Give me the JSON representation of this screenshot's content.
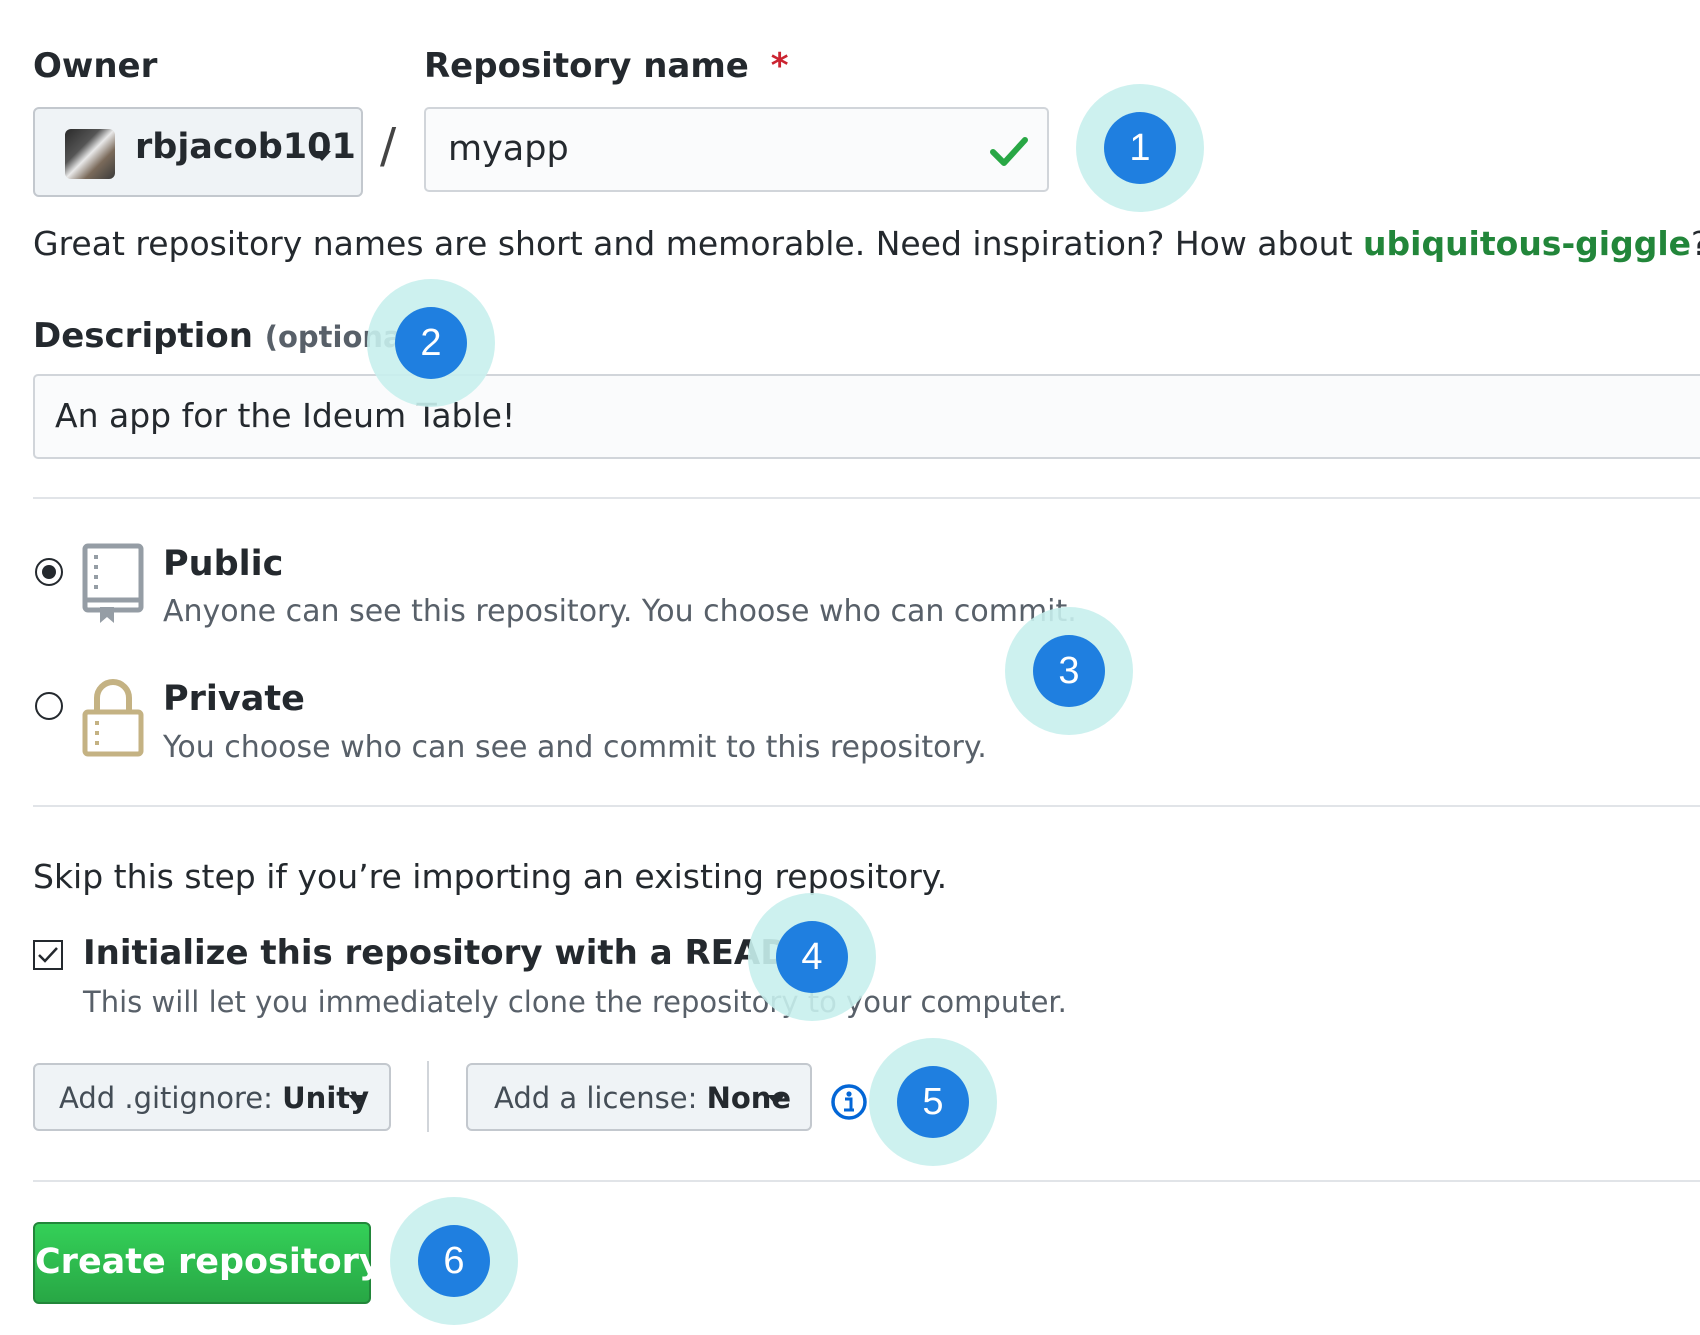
{
  "owner": {
    "label": "Owner",
    "selected": "rbjacob101",
    "avatar_icon": "user-avatar"
  },
  "separator": "/",
  "repo": {
    "label": "Repository name",
    "required_mark": "*",
    "value": "myapp",
    "valid_icon": "check-icon"
  },
  "hint": {
    "text": "Great repository names are short and memorable. Need inspiration? How about ",
    "suggestion": "ubiquitous-giggle",
    "end": "?"
  },
  "description": {
    "label": "Description",
    "optional": "(optional)",
    "value": "An app for the Ideum Table!"
  },
  "visibility": {
    "options": [
      {
        "label": "Public",
        "desc": "Anyone can see this repository. You choose who can commit.",
        "selected": true,
        "icon": "repo-book-icon"
      },
      {
        "label": "Private",
        "desc": "You choose who can see and commit to this repository.",
        "selected": false,
        "icon": "lock-icon"
      }
    ]
  },
  "init": {
    "skip_text": "Skip this step if you’re importing an existing repository.",
    "readme_label": "Initialize this repository with a README",
    "readme_desc": "This will let you immediately clone the repository to your computer.",
    "readme_checked": true
  },
  "gitignore": {
    "label": "Add .gitignore:",
    "value": "Unity"
  },
  "license": {
    "label": "Add a license:",
    "value": "None"
  },
  "create_button": "Create repository",
  "badges": [
    "1",
    "2",
    "3",
    "4",
    "5",
    "6"
  ],
  "colors": {
    "accent_green": "#28a745",
    "link_green": "#22863a",
    "badge_blue": "#1f7fe0",
    "badge_halo": "#c8efed",
    "info_blue": "#0366d6"
  }
}
